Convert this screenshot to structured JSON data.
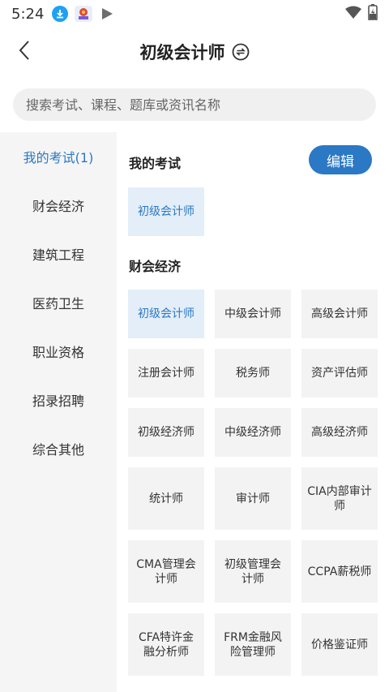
{
  "status_bar": {
    "time": "5:24",
    "icons": [
      "download-icon",
      "app-notification-icon",
      "play-store-icon",
      "wifi-icon",
      "battery-charging-icon"
    ]
  },
  "header": {
    "title": "初级会计师",
    "back_icon": "chevron-left-icon",
    "switch_icon": "switch-circle-icon"
  },
  "search": {
    "placeholder": "搜索考试、课程、题库或资讯名称"
  },
  "sidebar": {
    "items": [
      {
        "label": "我的考试(1)",
        "active": true
      },
      {
        "label": "财会经济",
        "active": false
      },
      {
        "label": "建筑工程",
        "active": false
      },
      {
        "label": "医药卫生",
        "active": false
      },
      {
        "label": "职业资格",
        "active": false
      },
      {
        "label": "招录招聘",
        "active": false
      },
      {
        "label": "综合其他",
        "active": false
      }
    ]
  },
  "my_exams": {
    "title": "我的考试",
    "edit_label": "编辑",
    "items": [
      {
        "label": "初级会计师",
        "selected": true
      }
    ]
  },
  "finance": {
    "title": "财会经济",
    "items": [
      {
        "label": "初级会计师",
        "selected": true
      },
      {
        "label": "中级会计师",
        "selected": false
      },
      {
        "label": "高级会计师",
        "selected": false
      },
      {
        "label": "注册会计师",
        "selected": false
      },
      {
        "label": "税务师",
        "selected": false
      },
      {
        "label": "资产评估师",
        "selected": false
      },
      {
        "label": "初级经济师",
        "selected": false
      },
      {
        "label": "中级经济师",
        "selected": false
      },
      {
        "label": "高级经济师",
        "selected": false
      },
      {
        "label": "统计师",
        "selected": false
      },
      {
        "label": "审计师",
        "selected": false
      },
      {
        "label": "CIA内部审计师",
        "selected": false
      },
      {
        "label": "CMA管理会计师",
        "selected": false
      },
      {
        "label": "初级管理会计师",
        "selected": false
      },
      {
        "label": "CCPA薪税师",
        "selected": false
      },
      {
        "label": "CFA特许金融分析师",
        "selected": false
      },
      {
        "label": "FRM金融风险管理师",
        "selected": false
      },
      {
        "label": "价格鉴证师",
        "selected": false
      }
    ]
  },
  "colors": {
    "accent": "#2b78c5",
    "selected_bg": "#e3eef8",
    "tile_bg": "#f3f3f3",
    "sidebar_bg": "#f5f5f5"
  }
}
